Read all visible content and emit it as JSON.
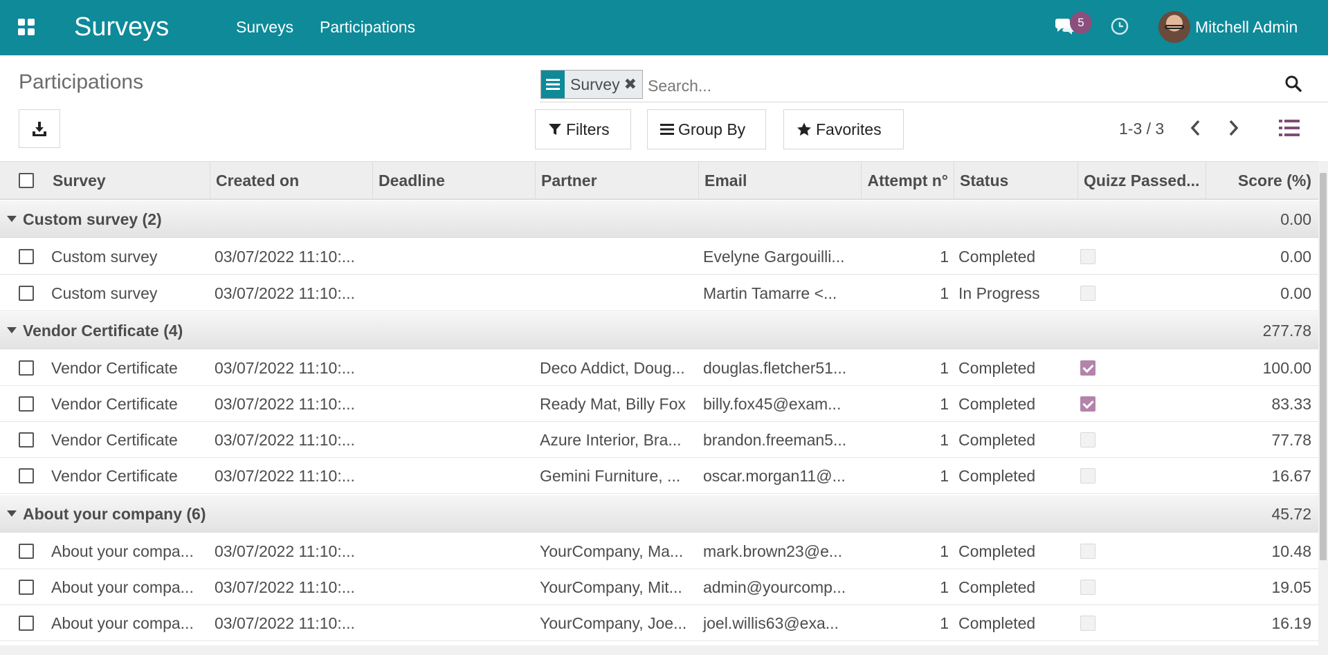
{
  "navbar": {
    "app_title": "Surveys",
    "menu": [
      "Surveys",
      "Participations"
    ],
    "messages_count": "5",
    "user_name": "Mitchell Admin",
    "icons": [
      "apps-icon",
      "chat-icon",
      "clock-icon",
      "avatar"
    ],
    "color": "#0e8a99"
  },
  "control_panel": {
    "breadcrumb": "Participations",
    "download_icon": "download-icon",
    "search": {
      "facet_label": "Survey",
      "placeholder": "Search..."
    },
    "filters_label": "Filters",
    "group_by_label": "Group By",
    "favorites_label": "Favorites",
    "pager": "1-3 / 3"
  },
  "table": {
    "columns": [
      "Survey",
      "Created on",
      "Deadline",
      "Partner",
      "Email",
      "Attempt n°",
      "Status",
      "Quizz Passed...",
      "Score (%)"
    ],
    "groups": [
      {
        "name": "Custom survey (2)",
        "score": "0.00",
        "rows": [
          {
            "survey": "Custom survey",
            "created": "03/07/2022 11:10:...",
            "deadline": "",
            "partner": "",
            "email": "Evelyne Gargouilli...",
            "attempt": "1",
            "status": "Completed",
            "quizz_passed": false,
            "score": "0.00"
          },
          {
            "survey": "Custom survey",
            "created": "03/07/2022 11:10:...",
            "deadline": "",
            "partner": "",
            "email": "Martin Tamarre <...",
            "attempt": "1",
            "status": "In Progress",
            "quizz_passed": false,
            "score": "0.00"
          }
        ]
      },
      {
        "name": "Vendor Certificate (4)",
        "score": "277.78",
        "rows": [
          {
            "survey": "Vendor Certificate",
            "created": "03/07/2022 11:10:...",
            "deadline": "",
            "partner": "Deco Addict, Doug...",
            "email": "douglas.fletcher51...",
            "attempt": "1",
            "status": "Completed",
            "quizz_passed": true,
            "score": "100.00"
          },
          {
            "survey": "Vendor Certificate",
            "created": "03/07/2022 11:10:...",
            "deadline": "",
            "partner": "Ready Mat, Billy Fox",
            "email": "billy.fox45@exam...",
            "attempt": "1",
            "status": "Completed",
            "quizz_passed": true,
            "score": "83.33"
          },
          {
            "survey": "Vendor Certificate",
            "created": "03/07/2022 11:10:...",
            "deadline": "",
            "partner": "Azure Interior, Bra...",
            "email": "brandon.freeman5...",
            "attempt": "1",
            "status": "Completed",
            "quizz_passed": false,
            "score": "77.78"
          },
          {
            "survey": "Vendor Certificate",
            "created": "03/07/2022 11:10:...",
            "deadline": "",
            "partner": "Gemini Furniture, ...",
            "email": "oscar.morgan11@...",
            "attempt": "1",
            "status": "Completed",
            "quizz_passed": false,
            "score": "16.67"
          }
        ]
      },
      {
        "name": "About your company (6)",
        "score": "45.72",
        "rows": [
          {
            "survey": "About your compa...",
            "created": "03/07/2022 11:10:...",
            "deadline": "",
            "partner": "YourCompany, Ma...",
            "email": "mark.brown23@e...",
            "attempt": "1",
            "status": "Completed",
            "quizz_passed": false,
            "score": "10.48"
          },
          {
            "survey": "About your compa...",
            "created": "03/07/2022 11:10:...",
            "deadline": "",
            "partner": "YourCompany, Mit...",
            "email": "admin@yourcomp...",
            "attempt": "1",
            "status": "Completed",
            "quizz_passed": false,
            "score": "19.05"
          },
          {
            "survey": "About your compa...",
            "created": "03/07/2022 11:10:...",
            "deadline": "",
            "partner": "YourCompany, Joe...",
            "email": "joel.willis63@exa...",
            "attempt": "1",
            "status": "Completed",
            "quizz_passed": false,
            "score": "16.19"
          }
        ]
      }
    ]
  }
}
